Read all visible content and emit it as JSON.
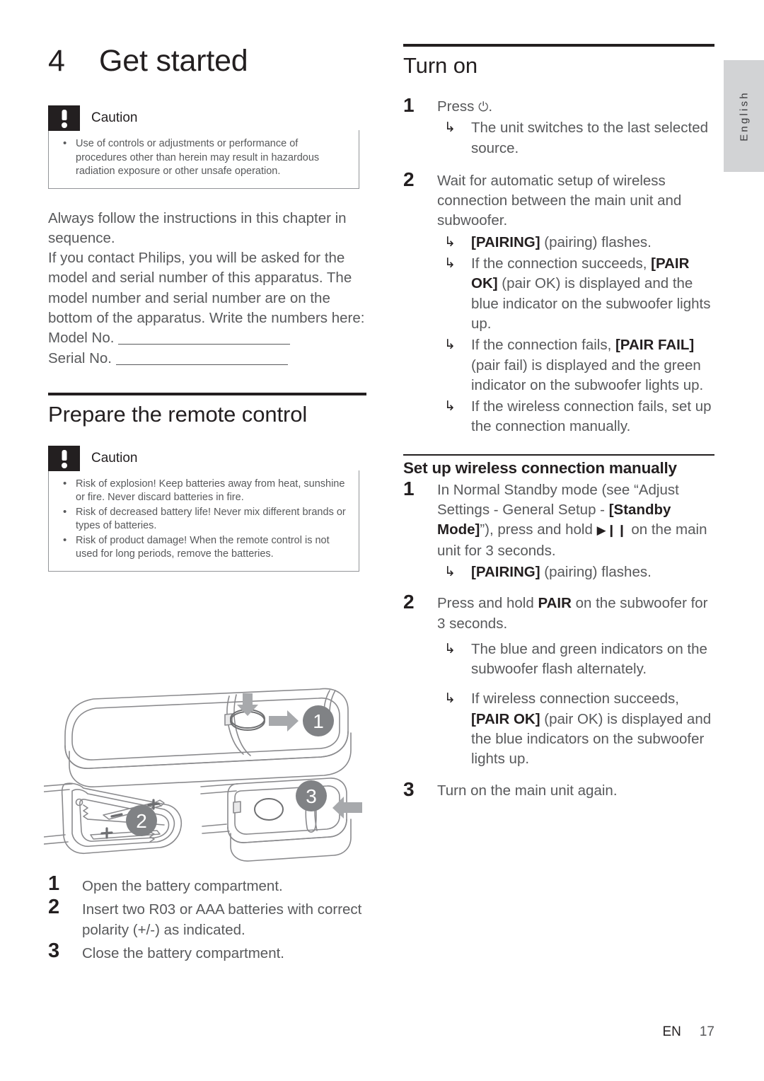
{
  "side_tab": {
    "language": "English"
  },
  "chapter": {
    "number": "4",
    "title": "Get started"
  },
  "caution_top": {
    "label": "Caution",
    "items": [
      "Use of controls or adjustments or performance of procedures other than herein may result in hazardous radiation exposure or other unsafe operation."
    ]
  },
  "intro": {
    "para1": "Always follow the instructions in this chapter in sequence.",
    "para2": "If you contact Philips, you will be asked for the model and serial number of this apparatus. The model number and serial number are on the bottom of the apparatus. Write the numbers here:",
    "model_label": "Model No.",
    "serial_label": "Serial No."
  },
  "remote_section": {
    "heading": "Prepare the remote control",
    "caution": {
      "label": "Caution",
      "items": [
        "Risk of explosion! Keep batteries away from heat, sunshine or fire. Never discard batteries in fire.",
        "Risk of decreased battery life! Never mix different brands or types of batteries.",
        "Risk of product damage! When the remote control is not used for long periods, remove the batteries."
      ]
    },
    "illustration": {
      "callout_1": "1",
      "callout_2": "2",
      "callout_3": "3",
      "battery_plus_top": "+",
      "battery_minus_top": "−",
      "battery_plus_bottom": "+",
      "battery_minus_bottom": "−"
    },
    "steps": [
      {
        "num": "1",
        "text": "Open the battery compartment."
      },
      {
        "num": "2",
        "text": "Insert two R03 or AAA batteries with correct polarity (+/-) as indicated."
      },
      {
        "num": "3",
        "text": "Close the battery compartment."
      }
    ]
  },
  "turn_on": {
    "heading": "Turn on",
    "step1": {
      "num": "1",
      "text_before": "Press",
      "glyph": "⏻",
      "text_after": ".",
      "results": [
        {
          "text": "The unit switches to the last selected source."
        }
      ]
    },
    "step2": {
      "num": "2",
      "text": "Wait for automatic setup of wireless connection between the main unit and subwoofer.",
      "results": [
        {
          "bold": "[PAIRING]",
          "rest": " (pairing) flashes."
        },
        {
          "pre": "If the connection succeeds, ",
          "bold": "[PAIR OK]",
          "rest": " (pair OK) is displayed and the blue indicator on the subwoofer lights up."
        },
        {
          "pre": "If the connection fails, ",
          "bold": "[PAIR FAIL]",
          "rest": " (pair fail) is displayed and the green indicator on the subwoofer lights up."
        },
        {
          "text": "If the wireless connection fails, set up the connection manually."
        }
      ]
    }
  },
  "manual_setup": {
    "heading": "Set up wireless connection manually",
    "step1": {
      "num": "1",
      "pre": "In Normal Standby mode (see “Adjust Settings - General Setup - ",
      "bold": "[Standby Mode]",
      "mid": "”), press and hold ",
      "glyph": "▶❙❙",
      "post": " on the main unit for 3 seconds.",
      "results": [
        {
          "bold": "[PAIRING]",
          "rest": " (pairing) flashes."
        }
      ]
    },
    "step2": {
      "num": "2",
      "pre": "Press and hold ",
      "bold": "PAIR",
      "post": " on the subwoofer for 3 seconds.",
      "results": [
        {
          "text": "The blue and green indicators on the subwoofer flash alternately."
        },
        {
          "pre": "If wireless connection succeeds, ",
          "bold": "[PAIR OK]",
          "rest": " (pair OK) is displayed and the blue indicators on the subwoofer lights up."
        }
      ]
    },
    "step3": {
      "num": "3",
      "text": "Turn on the main unit again."
    }
  },
  "footer": {
    "lang_code": "EN",
    "page_number": "17"
  }
}
